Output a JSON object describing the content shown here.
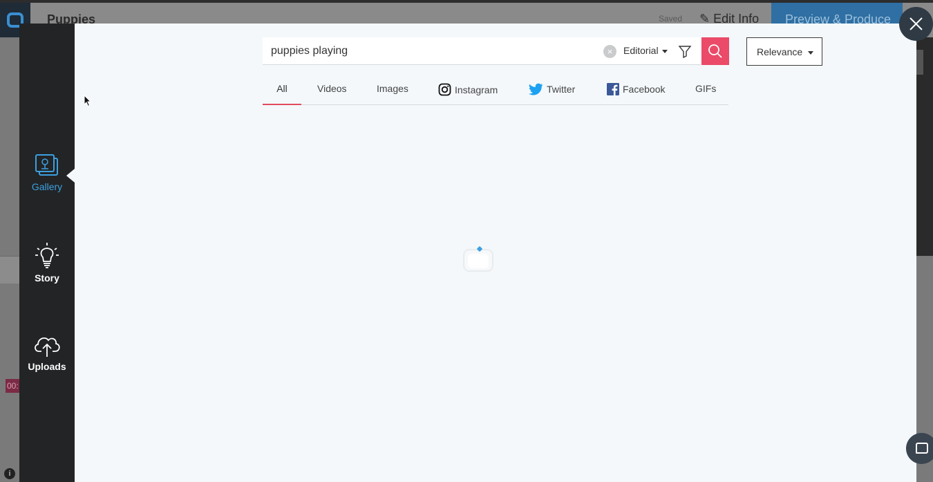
{
  "background_app": {
    "title": "Puppies",
    "saved_label": "Saved",
    "edit_info_label": "Edit Info",
    "preview_label": "Preview & Produce",
    "timecode": "00:",
    "info_label": "i"
  },
  "sidebar": {
    "items": [
      {
        "label": "Gallery",
        "icon": "gallery-icon",
        "active": true
      },
      {
        "label": "Story",
        "icon": "lightbulb-icon",
        "active": false
      },
      {
        "label": "Uploads",
        "icon": "cloud-upload-icon",
        "active": false
      }
    ]
  },
  "search": {
    "value": "puppies playing",
    "placeholder": "",
    "clear_symbol": "×",
    "type_label": "Editorial",
    "filter_icon": "filter-icon",
    "search_icon": "search-icon"
  },
  "sort": {
    "label": "Relevance"
  },
  "tabs": [
    {
      "label": "All",
      "active": true
    },
    {
      "label": "Videos",
      "active": false
    },
    {
      "label": "Images",
      "active": false
    },
    {
      "label": "Instagram",
      "active": false,
      "icon": "instagram-icon"
    },
    {
      "label": "Twitter",
      "active": false,
      "icon": "twitter-icon"
    },
    {
      "label": "Facebook",
      "active": false,
      "icon": "facebook-icon"
    },
    {
      "label": "GIFs",
      "active": false
    }
  ],
  "colors": {
    "accent_blue": "#3da0e0",
    "search_button": "#eb4a68",
    "active_tab_underline": "#e24a5c",
    "rail_bg": "#222426",
    "modal_bg": "#f4f8fb"
  }
}
